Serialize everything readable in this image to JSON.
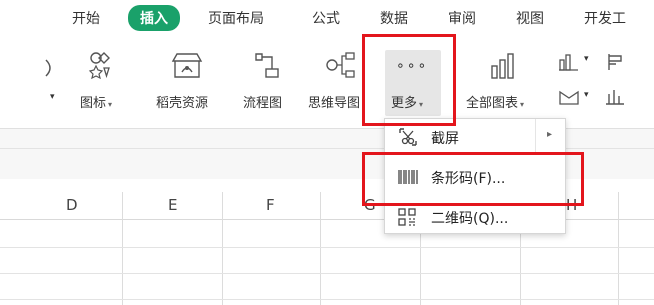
{
  "tabs": [
    {
      "label": "开始"
    },
    {
      "label": "插入",
      "active": true
    },
    {
      "label": "页面布局"
    },
    {
      "label": "公式"
    },
    {
      "label": "数据"
    },
    {
      "label": "审阅"
    },
    {
      "label": "视图"
    },
    {
      "label": "开发工"
    }
  ],
  "ribbon": {
    "icons_label": "图标",
    "docer_label": "稻壳资源",
    "flowchart_label": "流程图",
    "mindmap_label": "思维导图",
    "more_label": "更多",
    "all_charts_label": "全部图表"
  },
  "menu": {
    "items": [
      {
        "label": "截屏",
        "icon": "screenshot-icon"
      },
      {
        "label": "条形码(F)...",
        "icon": "barcode-icon"
      },
      {
        "label": "二维码(Q)...",
        "icon": "qrcode-icon"
      }
    ]
  },
  "columns": [
    "D",
    "E",
    "F",
    "G",
    "H"
  ],
  "colors": {
    "accent": "#1aa16a",
    "highlight": "#e3151c"
  }
}
